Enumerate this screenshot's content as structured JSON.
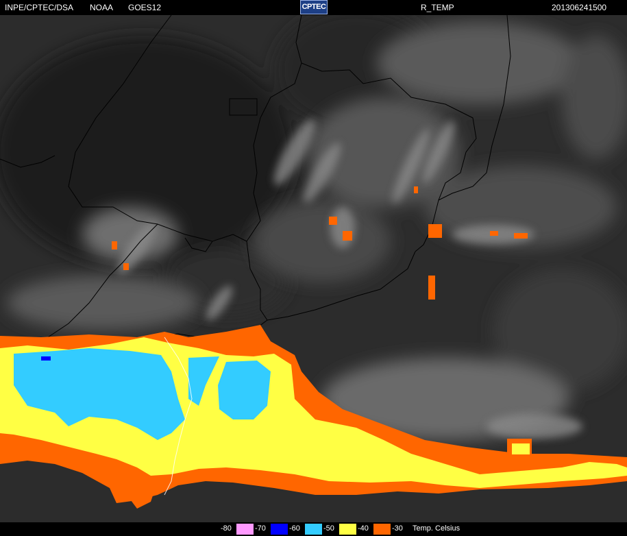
{
  "header": {
    "agency": "INPE/CPTEC/DSA",
    "source": "NOAA",
    "satellite": "GOES12",
    "logo_text": "CPTEC",
    "product": "R_TEMP",
    "timestamp": "201306241500"
  },
  "legend": {
    "title": "Temp. Celsius",
    "items": [
      {
        "label": "-80",
        "color": "#ff99ff"
      },
      {
        "label": "-70",
        "color": "#ff99ff"
      },
      {
        "label": "-60",
        "color": "#0000ff"
      },
      {
        "label": "-50",
        "color": "#33ccff"
      },
      {
        "label": "-40",
        "color": "#ffff44"
      },
      {
        "label": "-30",
        "color": "#ff6600"
      }
    ]
  },
  "colors": {
    "cloud_minus30": "#ff6600",
    "cloud_minus40": "#ffff44",
    "cloud_minus50": "#33ccff",
    "cloud_minus60": "#0000ff",
    "background": "#2a2a2a",
    "borders": "#000000"
  }
}
